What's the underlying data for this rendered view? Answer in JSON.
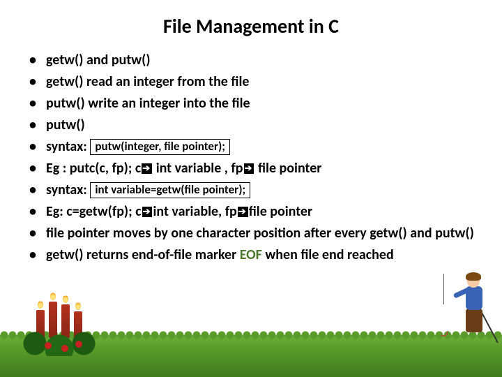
{
  "title": "File Management in C",
  "bullets": {
    "b1": "getw() and putw()",
    "b2": "getw()  read an integer from the file",
    "b3": "putw() write an integer into the file",
    "b4": "putw()",
    "b5_prefix": "syntax: ",
    "b5_box": "putw(integer, file pointer);",
    "b6_a": "Eg :   putc(c, fp);    c",
    "b6_b": " int variable , fp",
    "b6_c": " file pointer",
    "b7_prefix": "syntax: ",
    "b7_box": "int variable=getw(file pointer);",
    "b8_a": "Eg:    c=getw(fp);  c",
    "b8_b": "int variable, fp",
    "b8_c": "file pointer",
    "b9": "file pointer moves by one character position after every getw() and putw()",
    "b10_a": "getw() returns end-of-file marker ",
    "b10_eof": "EOF",
    "b10_b": " when file end reached"
  },
  "glyphs": {
    "arrow": "➔"
  }
}
